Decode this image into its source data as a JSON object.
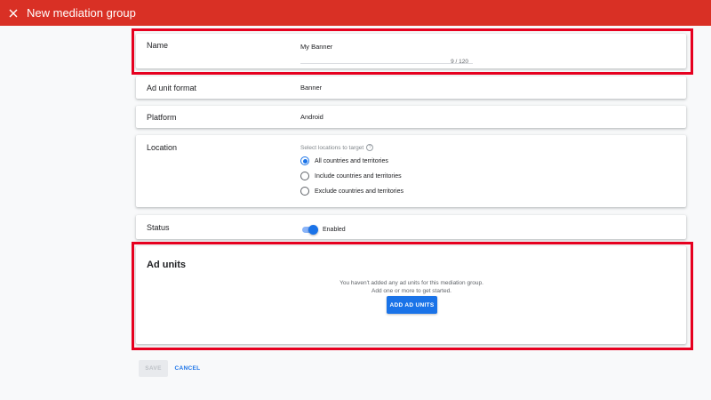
{
  "header": {
    "title": "New mediation group",
    "close_icon": "close-icon",
    "background": "#d93025"
  },
  "form": {
    "name": {
      "label": "Name",
      "value": "My Banner",
      "counter": "9 / 120"
    },
    "ad_unit_format": {
      "label": "Ad unit format",
      "value": "Banner"
    },
    "platform": {
      "label": "Platform",
      "value": "Android"
    },
    "location": {
      "label": "Location",
      "hint": "Select locations to target",
      "hint_icon": "help-icon",
      "options": [
        {
          "label": "All countries and territories",
          "checked": true
        },
        {
          "label": "Include countries and territories",
          "checked": false
        },
        {
          "label": "Exclude countries and territories",
          "checked": false
        }
      ]
    },
    "status": {
      "label": "Status",
      "toggle_state": "on",
      "toggle_label": "Enabled"
    },
    "ad_units": {
      "title": "Ad units",
      "empty_message": "You haven't added any ad units for this mediation group. Add one or more to get started.",
      "add_button": "ADD AD UNITS"
    }
  },
  "actions": {
    "save_label": "SAVE",
    "cancel_label": "CANCEL"
  },
  "colors": {
    "accent": "#1a73e8",
    "highlight": "#e6001f"
  }
}
